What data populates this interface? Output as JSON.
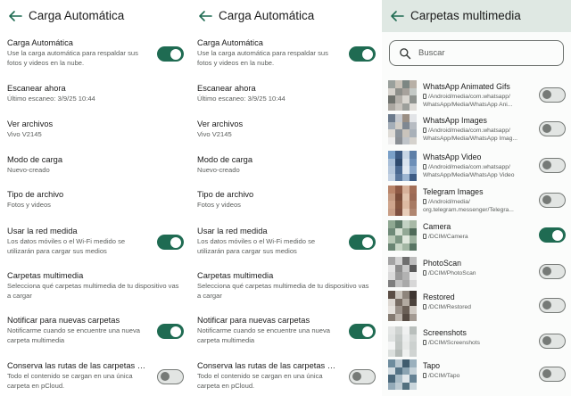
{
  "colors": {
    "accent": "#1f6b52",
    "toggle_off": "#767a77",
    "header_bg": "#dfe8e3"
  },
  "settings_screen": {
    "title": "Carga Automática",
    "items": [
      {
        "title": "Carga Automática",
        "subtitle": "Use la carga automática para respaldar sus fotos y videos en la nube.",
        "toggle": true,
        "on": true
      },
      {
        "title": "Escanear ahora",
        "subtitle": "Último escaneo: 3/9/25 10:44",
        "toggle": false
      },
      {
        "title": "Ver archivos",
        "subtitle": "Vivo V2145",
        "toggle": false
      },
      {
        "title": "Modo de carga",
        "subtitle": "Nuevo-creado",
        "toggle": false
      },
      {
        "title": "Tipo de archivo",
        "subtitle": "Fotos y videos",
        "toggle": false
      },
      {
        "title": "Usar la red medida",
        "subtitle": "Los datos móviles o el Wi-Fi medido se utilizarán para cargar sus medios",
        "toggle": true,
        "on": true
      },
      {
        "title": "Carpetas multimedia",
        "subtitle": "Selecciona qué carpetas multimedia de tu dispositivo vas a cargar",
        "toggle": false
      },
      {
        "title": "Notificar para nuevas carpetas",
        "subtitle": "Notificarme cuando se encuentre una nueva carpeta multimedia",
        "toggle": true,
        "on": true
      },
      {
        "title": "Conserva las rutas de las carpetas m...",
        "subtitle": "Todo el contenido se cargan en una única carpeta en pCloud.",
        "toggle": true,
        "on": false
      }
    ]
  },
  "folders_screen": {
    "title": "Carpetas multimedia",
    "search_placeholder": "Buscar",
    "folders": [
      {
        "name": "WhatsApp Animated Gifs",
        "path": "/Android/media/com.whatsapp/ WhatsApp/Media/WhatsApp Ani...",
        "on": false
      },
      {
        "name": "WhatsApp Images",
        "path": "/Android/media/com.whatsapp/ WhatsApp/Media/WhatsApp Imag...",
        "on": false
      },
      {
        "name": "WhatsApp Video",
        "path": "/Android/media/com.whatsapp/ WhatsApp/Media/WhatsApp Video",
        "on": false
      },
      {
        "name": "Telegram Images",
        "path": "/Android/media/ org.telegram.messenger/Telegra...",
        "on": false
      },
      {
        "name": "Camera",
        "path": "/DCIM/Camera",
        "on": true
      },
      {
        "name": "PhotoScan",
        "path": "/DCIM/PhotoScan",
        "on": false
      },
      {
        "name": "Restored",
        "path": "/DCIM/Restored",
        "on": false
      },
      {
        "name": "Screenshots",
        "path": "/DCIM/Screenshots",
        "on": false
      },
      {
        "name": "Tapo",
        "path": "/DCIM/Tapo",
        "on": false
      }
    ]
  }
}
